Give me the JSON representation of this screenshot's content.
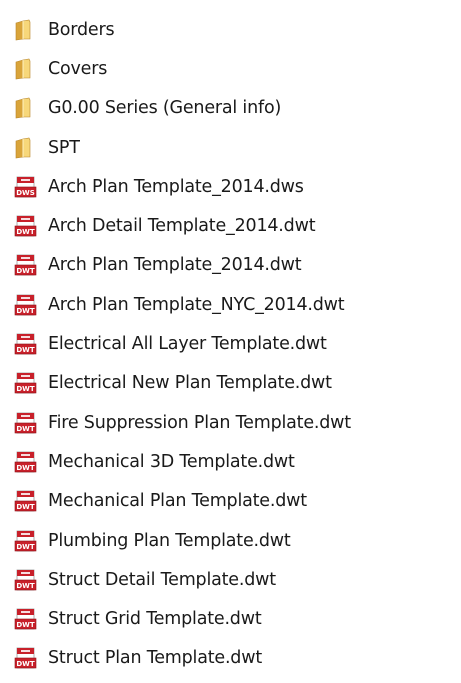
{
  "colors": {
    "folder_light": "#f7d77a",
    "folder_dark": "#d9a43a",
    "folder_edge": "#b8862a",
    "dwg_red": "#c8202a",
    "dwg_red_dark": "#8e1218",
    "page_white": "#ffffff"
  },
  "items": [
    {
      "label": "Borders",
      "type": "folder",
      "icon": "folder-icon"
    },
    {
      "label": "Covers",
      "type": "folder",
      "icon": "folder-icon"
    },
    {
      "label": "G0.00 Series (General info)",
      "type": "folder",
      "icon": "folder-icon"
    },
    {
      "label": "SPT",
      "type": "folder",
      "icon": "folder-icon"
    },
    {
      "label": "Arch Plan Template_2014.dws",
      "type": "dws",
      "icon": "dws-file-icon",
      "badge": "DWS"
    },
    {
      "label": "Arch Detail Template_2014.dwt",
      "type": "dwt",
      "icon": "dwt-file-icon",
      "badge": "DWT"
    },
    {
      "label": "Arch Plan Template_2014.dwt",
      "type": "dwt",
      "icon": "dwt-file-icon",
      "badge": "DWT"
    },
    {
      "label": "Arch Plan Template_NYC_2014.dwt",
      "type": "dwt",
      "icon": "dwt-file-icon",
      "badge": "DWT"
    },
    {
      "label": "Electrical All Layer Template.dwt",
      "type": "dwt",
      "icon": "dwt-file-icon",
      "badge": "DWT"
    },
    {
      "label": "Electrical New Plan Template.dwt",
      "type": "dwt",
      "icon": "dwt-file-icon",
      "badge": "DWT"
    },
    {
      "label": "Fire Suppression Plan Template.dwt",
      "type": "dwt",
      "icon": "dwt-file-icon",
      "badge": "DWT"
    },
    {
      "label": "Mechanical 3D Template.dwt",
      "type": "dwt",
      "icon": "dwt-file-icon",
      "badge": "DWT"
    },
    {
      "label": "Mechanical Plan Template.dwt",
      "type": "dwt",
      "icon": "dwt-file-icon",
      "badge": "DWT"
    },
    {
      "label": "Plumbing Plan Template.dwt",
      "type": "dwt",
      "icon": "dwt-file-icon",
      "badge": "DWT"
    },
    {
      "label": "Struct Detail Template.dwt",
      "type": "dwt",
      "icon": "dwt-file-icon",
      "badge": "DWT"
    },
    {
      "label": "Struct Grid Template.dwt",
      "type": "dwt",
      "icon": "dwt-file-icon",
      "badge": "DWT"
    },
    {
      "label": "Struct Plan Template.dwt",
      "type": "dwt",
      "icon": "dwt-file-icon",
      "badge": "DWT"
    }
  ]
}
